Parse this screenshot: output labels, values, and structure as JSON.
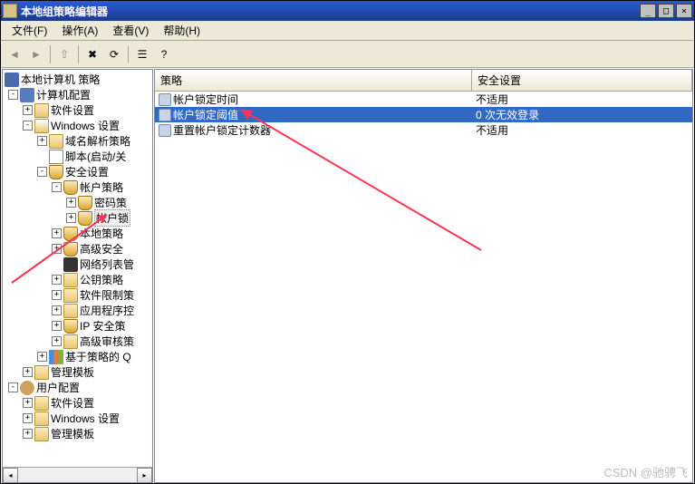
{
  "window": {
    "title": "本地组策略编辑器"
  },
  "menu": {
    "file": "文件(F)",
    "action": "操作(A)",
    "view": "查看(V)",
    "help": "帮助(H)"
  },
  "tree": {
    "root": "本地计算机 策略",
    "computer_config": "计算机配置",
    "software_settings": "软件设置",
    "windows_settings": "Windows 设置",
    "dns_policy": "域名解析策略",
    "scripts": "脚本(启动/关",
    "security_settings": "安全设置",
    "account_policy": "帐户策略",
    "password_policy": "密码策",
    "lockout_policy": "帐户锁",
    "local_policy": "本地策略",
    "advanced_security": "高级安全",
    "network_list": "网络列表管",
    "public_key": "公钥策略",
    "software_restrict": "软件限制策",
    "app_control": "应用程序控",
    "ip_security": "IP 安全策",
    "advanced_audit": "高级审核策",
    "policy_based_q": "基于策略的 Q",
    "admin_templates": "管理模板",
    "user_config": "用户配置",
    "u_software_settings": "软件设置",
    "u_windows_settings": "Windows 设置",
    "u_admin_templates": "管理模板"
  },
  "list": {
    "header_policy": "策略",
    "header_security": "安全设置",
    "rows": [
      {
        "name": "帐户锁定时间",
        "value": "不适用",
        "selected": false
      },
      {
        "name": "帐户锁定阈值",
        "value": "0 次无效登录",
        "selected": true
      },
      {
        "name": "重置帐户锁定计数器",
        "value": "不适用",
        "selected": false
      }
    ]
  },
  "watermark": "CSDN @驰骋飞"
}
